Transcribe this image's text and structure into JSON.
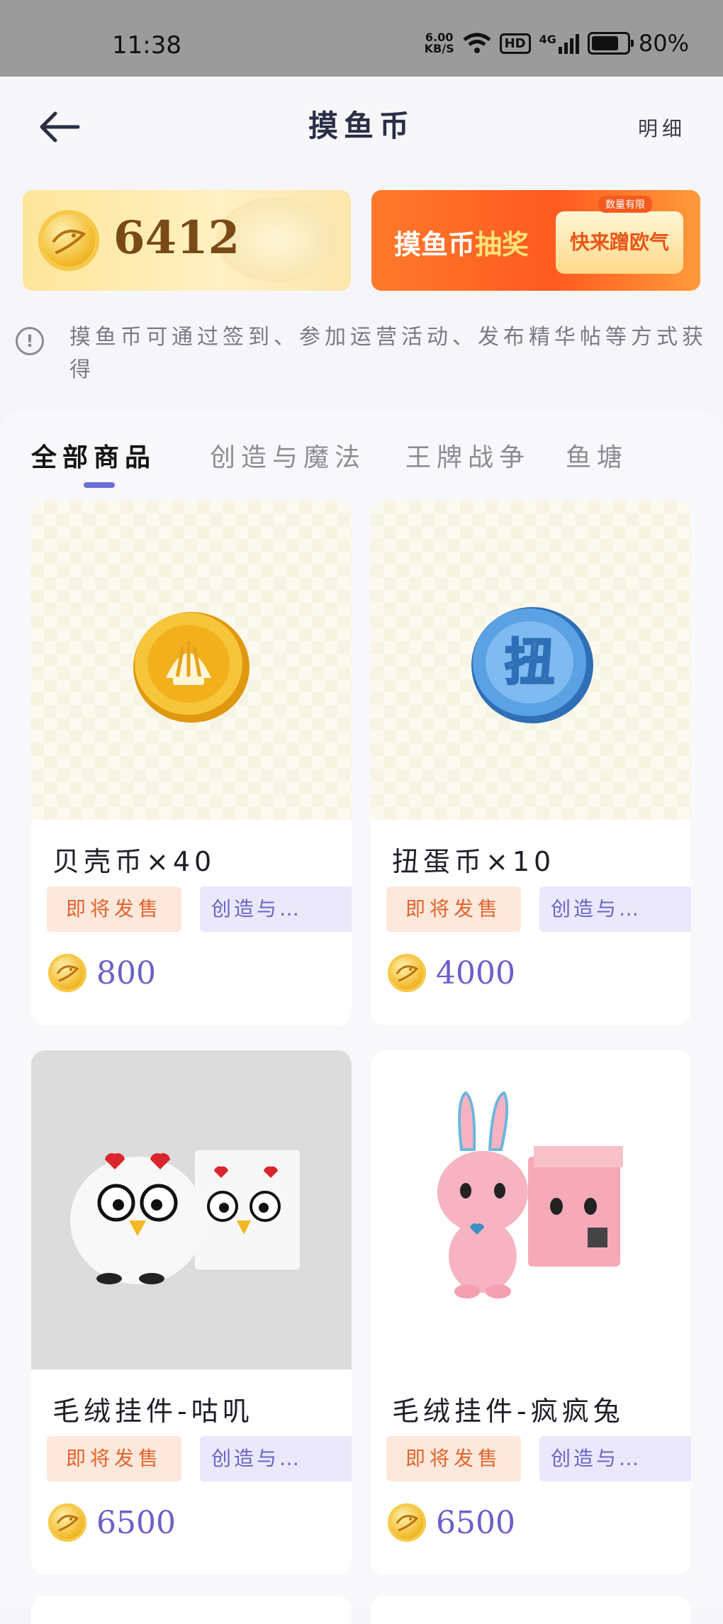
{
  "status_bar": {
    "time": "11:38",
    "net_speed_value": "6.00",
    "net_speed_unit": "KB/S",
    "hd_badge": "HD",
    "network_type": "4G",
    "battery": "80%"
  },
  "header": {
    "title": "摸鱼币",
    "detail_link": "明细"
  },
  "balance": {
    "amount": "6412"
  },
  "lottery_banner": {
    "title_prefix": "摸鱼币",
    "title_highlight": "抽奖",
    "tag": "数量有限",
    "pill_text": "快来蹭欧气"
  },
  "info": {
    "text": "摸鱼币可通过签到、参加运营活动、发布精华帖等方式获得"
  },
  "tabs": [
    {
      "label": "全部商品",
      "active": true
    },
    {
      "label": "创造与魔法",
      "active": false
    },
    {
      "label": "王牌战争",
      "active": false
    },
    {
      "label": "鱼塘",
      "active": false
    }
  ],
  "products": [
    {
      "name": "贝壳币×40",
      "sale_tag": "即将发售",
      "category_tag": "创造与…",
      "price": "800",
      "image": "shell-coin"
    },
    {
      "name": "扭蛋币×10",
      "sale_tag": "即将发售",
      "category_tag": "创造与…",
      "price": "4000",
      "image": "gacha-coin"
    },
    {
      "name": "毛绒挂件-咕叽",
      "sale_tag": "即将发售",
      "category_tag": "创造与…",
      "price": "6500",
      "image": "plush-chicken"
    },
    {
      "name": "毛绒挂件-疯疯兔",
      "sale_tag": "即将发售",
      "category_tag": "创造与…",
      "price": "6500",
      "image": "plush-rabbit"
    }
  ],
  "colors": {
    "accent": "#6a6fd6",
    "price": "#6b5fc9",
    "sale_tag_bg": "#fde8dc",
    "sale_tag_text": "#e3642d",
    "category_tag_bg": "#ebe8fb"
  }
}
